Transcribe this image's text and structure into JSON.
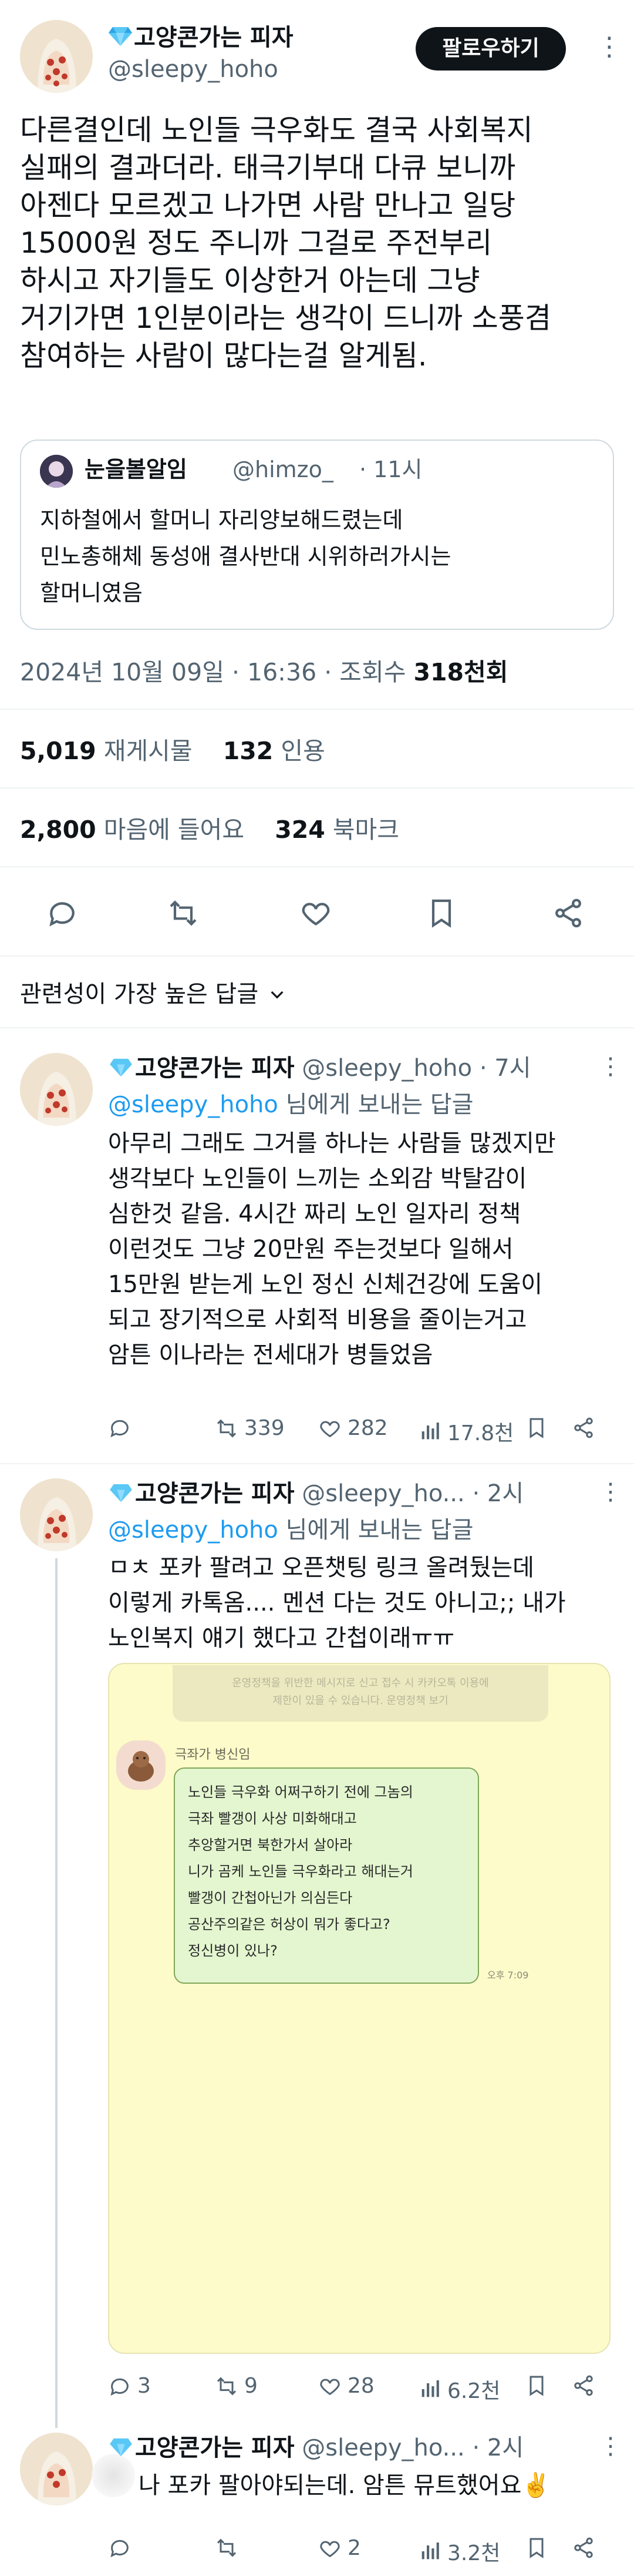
{
  "main_tweet": {
    "display_name": "고양콘가는 피자",
    "handle": "@sleepy_hoho",
    "follow_button": "팔로우하기",
    "more": "⋮",
    "body_lines": [
      "다른결인데 노인들 극우화도 결국 사회복지",
      "실패의 결과더라. 태극기부대 다큐 보니까",
      "아젠다 모르겠고 나가면 사람 만나고 일당",
      "15000원 정도 주니까 그걸로 주전부리",
      "하시고 자기들도 이상한거 아는데 그냥",
      "거기가면 1인분이라는 생각이 드니까 소풍겸",
      "참여하는 사람이 많다는걸 알게됨."
    ],
    "quote": {
      "display_name": "눈을볼알임",
      "handle": "@himzo_",
      "time": "· 11시",
      "lines": [
        "지하철에서 할머니 자리양보해드렸는데",
        "민노총해체 동성애 결사반대 시위하러가시는",
        "할머니였음"
      ]
    },
    "timestamp": "2024년 10월 09일 · 16:36 · 조회수",
    "views": "318천회",
    "retweets_count": "5,019",
    "retweets_label": "재게시물",
    "quotes_count": "132",
    "quotes_label": "인용",
    "likes_count": "2,800",
    "likes_label": "마음에 들어요",
    "bookmarks_count": "324",
    "bookmarks_label": "북마크"
  },
  "sort_label": "관련성이 가장 높은 답글",
  "replies": [
    {
      "display_name": "고양콘가는 피자",
      "handle": "@sleepy_hoho",
      "time": "· 7시",
      "reply_to": "@sleepy_hoho",
      "reply_to_suffix": "님에게 보내는 답글",
      "lines": [
        "아무리 그래도 그거를 하나는 사람들 많겠지만",
        "생각보다 노인들이 느끼는 소외감 박탈감이",
        "심한것 같음. 4시간 짜리 노인 일자리 정책",
        "이런것도 그냥 20만원 주는것보다 일해서",
        "15만원 받는게 노인 정신 신체건강에 도움이",
        "되고 장기적으로 사회적 비용을 줄이는거고",
        "암튼 이나라는 전세대가 병들었음"
      ],
      "replies": "",
      "retweets": "339",
      "likes": "282",
      "views": "17.8천"
    },
    {
      "display_name": "고양콘가는 피자",
      "handle": "@sleepy_ho...",
      "time": "· 2시",
      "reply_to": "@sleepy_hoho",
      "reply_to_suffix": "님에게 보내는 답글",
      "lines": [
        "ㅁㅊ 포카 팔려고 오픈챗팅 링크 올려뒀는데",
        "이렇게 카톡옴.... 멘션 다는 것도 아니고;; 내가",
        "노인복지 얘기 했다고 간첩이래ㅠㅠ"
      ],
      "replies": "3",
      "retweets": "9",
      "likes": "28",
      "views": "6.2천"
    },
    {
      "display_name": "고양콘가는 피자",
      "handle": "@sleepy_ho...",
      "time": "· 2시",
      "lines": [
        "나 포카 팔아야되는데. 암튼 뮤트했어요✌️"
      ],
      "replies": "",
      "retweets": "",
      "likes": "2",
      "views": "3.2천"
    }
  ],
  "chat_image": {
    "notice_lines": [
      "운영정책을 위반한 메시지로 신고 접수 시 카카오톡 이용에",
      "제한이 있을 수 있습니다.  운영정책 보기"
    ],
    "sender": "극좌가 병신임",
    "bubble_lines": [
      "노인들 극우화 어쩌구하기 전에 그놈의",
      "극좌 빨갱이 사상 미화해대고",
      "추앙할거면 북한가서 살아라",
      "니가 곰케 노인들 극우화라고 해대는거",
      "빨갱이 간첩아닌가 의심든다",
      "공산주의같은 허상이 뭐가 좋다고?",
      "정신병이 있나?"
    ],
    "time": "오후 7:09"
  },
  "colors": {
    "accent": "#1d9bf0",
    "text": "#0f1419",
    "muted": "#536471",
    "chat_bg": "#fdfbc9",
    "bubble_bg": "#e3f6cf"
  }
}
